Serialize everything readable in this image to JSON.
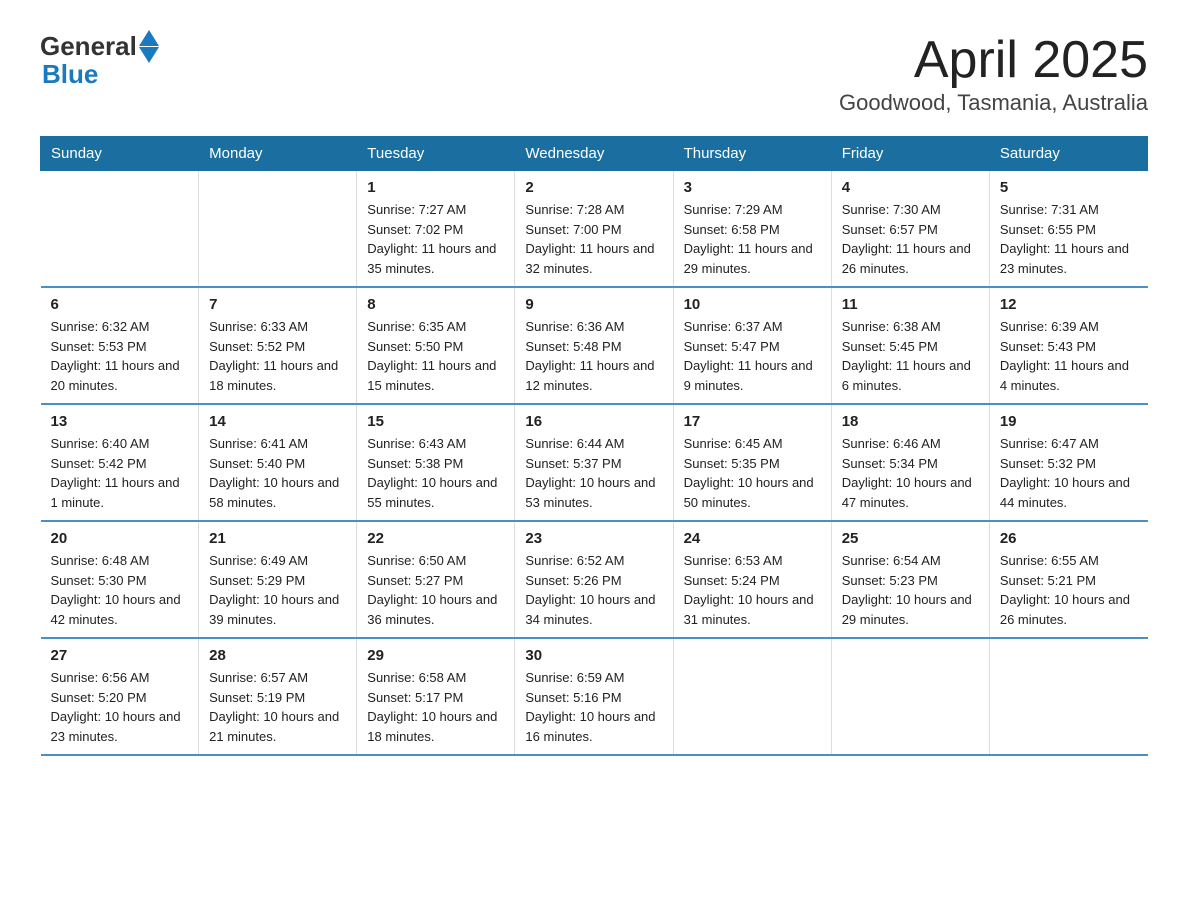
{
  "header": {
    "logo_general": "General",
    "logo_blue": "Blue",
    "title": "April 2025",
    "subtitle": "Goodwood, Tasmania, Australia"
  },
  "weekdays": [
    "Sunday",
    "Monday",
    "Tuesday",
    "Wednesday",
    "Thursday",
    "Friday",
    "Saturday"
  ],
  "weeks": [
    [
      {
        "day": "",
        "sunrise": "",
        "sunset": "",
        "daylight": ""
      },
      {
        "day": "",
        "sunrise": "",
        "sunset": "",
        "daylight": ""
      },
      {
        "day": "1",
        "sunrise": "Sunrise: 7:27 AM",
        "sunset": "Sunset: 7:02 PM",
        "daylight": "Daylight: 11 hours and 35 minutes."
      },
      {
        "day": "2",
        "sunrise": "Sunrise: 7:28 AM",
        "sunset": "Sunset: 7:00 PM",
        "daylight": "Daylight: 11 hours and 32 minutes."
      },
      {
        "day": "3",
        "sunrise": "Sunrise: 7:29 AM",
        "sunset": "Sunset: 6:58 PM",
        "daylight": "Daylight: 11 hours and 29 minutes."
      },
      {
        "day": "4",
        "sunrise": "Sunrise: 7:30 AM",
        "sunset": "Sunset: 6:57 PM",
        "daylight": "Daylight: 11 hours and 26 minutes."
      },
      {
        "day": "5",
        "sunrise": "Sunrise: 7:31 AM",
        "sunset": "Sunset: 6:55 PM",
        "daylight": "Daylight: 11 hours and 23 minutes."
      }
    ],
    [
      {
        "day": "6",
        "sunrise": "Sunrise: 6:32 AM",
        "sunset": "Sunset: 5:53 PM",
        "daylight": "Daylight: 11 hours and 20 minutes."
      },
      {
        "day": "7",
        "sunrise": "Sunrise: 6:33 AM",
        "sunset": "Sunset: 5:52 PM",
        "daylight": "Daylight: 11 hours and 18 minutes."
      },
      {
        "day": "8",
        "sunrise": "Sunrise: 6:35 AM",
        "sunset": "Sunset: 5:50 PM",
        "daylight": "Daylight: 11 hours and 15 minutes."
      },
      {
        "day": "9",
        "sunrise": "Sunrise: 6:36 AM",
        "sunset": "Sunset: 5:48 PM",
        "daylight": "Daylight: 11 hours and 12 minutes."
      },
      {
        "day": "10",
        "sunrise": "Sunrise: 6:37 AM",
        "sunset": "Sunset: 5:47 PM",
        "daylight": "Daylight: 11 hours and 9 minutes."
      },
      {
        "day": "11",
        "sunrise": "Sunrise: 6:38 AM",
        "sunset": "Sunset: 5:45 PM",
        "daylight": "Daylight: 11 hours and 6 minutes."
      },
      {
        "day": "12",
        "sunrise": "Sunrise: 6:39 AM",
        "sunset": "Sunset: 5:43 PM",
        "daylight": "Daylight: 11 hours and 4 minutes."
      }
    ],
    [
      {
        "day": "13",
        "sunrise": "Sunrise: 6:40 AM",
        "sunset": "Sunset: 5:42 PM",
        "daylight": "Daylight: 11 hours and 1 minute."
      },
      {
        "day": "14",
        "sunrise": "Sunrise: 6:41 AM",
        "sunset": "Sunset: 5:40 PM",
        "daylight": "Daylight: 10 hours and 58 minutes."
      },
      {
        "day": "15",
        "sunrise": "Sunrise: 6:43 AM",
        "sunset": "Sunset: 5:38 PM",
        "daylight": "Daylight: 10 hours and 55 minutes."
      },
      {
        "day": "16",
        "sunrise": "Sunrise: 6:44 AM",
        "sunset": "Sunset: 5:37 PM",
        "daylight": "Daylight: 10 hours and 53 minutes."
      },
      {
        "day": "17",
        "sunrise": "Sunrise: 6:45 AM",
        "sunset": "Sunset: 5:35 PM",
        "daylight": "Daylight: 10 hours and 50 minutes."
      },
      {
        "day": "18",
        "sunrise": "Sunrise: 6:46 AM",
        "sunset": "Sunset: 5:34 PM",
        "daylight": "Daylight: 10 hours and 47 minutes."
      },
      {
        "day": "19",
        "sunrise": "Sunrise: 6:47 AM",
        "sunset": "Sunset: 5:32 PM",
        "daylight": "Daylight: 10 hours and 44 minutes."
      }
    ],
    [
      {
        "day": "20",
        "sunrise": "Sunrise: 6:48 AM",
        "sunset": "Sunset: 5:30 PM",
        "daylight": "Daylight: 10 hours and 42 minutes."
      },
      {
        "day": "21",
        "sunrise": "Sunrise: 6:49 AM",
        "sunset": "Sunset: 5:29 PM",
        "daylight": "Daylight: 10 hours and 39 minutes."
      },
      {
        "day": "22",
        "sunrise": "Sunrise: 6:50 AM",
        "sunset": "Sunset: 5:27 PM",
        "daylight": "Daylight: 10 hours and 36 minutes."
      },
      {
        "day": "23",
        "sunrise": "Sunrise: 6:52 AM",
        "sunset": "Sunset: 5:26 PM",
        "daylight": "Daylight: 10 hours and 34 minutes."
      },
      {
        "day": "24",
        "sunrise": "Sunrise: 6:53 AM",
        "sunset": "Sunset: 5:24 PM",
        "daylight": "Daylight: 10 hours and 31 minutes."
      },
      {
        "day": "25",
        "sunrise": "Sunrise: 6:54 AM",
        "sunset": "Sunset: 5:23 PM",
        "daylight": "Daylight: 10 hours and 29 minutes."
      },
      {
        "day": "26",
        "sunrise": "Sunrise: 6:55 AM",
        "sunset": "Sunset: 5:21 PM",
        "daylight": "Daylight: 10 hours and 26 minutes."
      }
    ],
    [
      {
        "day": "27",
        "sunrise": "Sunrise: 6:56 AM",
        "sunset": "Sunset: 5:20 PM",
        "daylight": "Daylight: 10 hours and 23 minutes."
      },
      {
        "day": "28",
        "sunrise": "Sunrise: 6:57 AM",
        "sunset": "Sunset: 5:19 PM",
        "daylight": "Daylight: 10 hours and 21 minutes."
      },
      {
        "day": "29",
        "sunrise": "Sunrise: 6:58 AM",
        "sunset": "Sunset: 5:17 PM",
        "daylight": "Daylight: 10 hours and 18 minutes."
      },
      {
        "day": "30",
        "sunrise": "Sunrise: 6:59 AM",
        "sunset": "Sunset: 5:16 PM",
        "daylight": "Daylight: 10 hours and 16 minutes."
      },
      {
        "day": "",
        "sunrise": "",
        "sunset": "",
        "daylight": ""
      },
      {
        "day": "",
        "sunrise": "",
        "sunset": "",
        "daylight": ""
      },
      {
        "day": "",
        "sunrise": "",
        "sunset": "",
        "daylight": ""
      }
    ]
  ]
}
